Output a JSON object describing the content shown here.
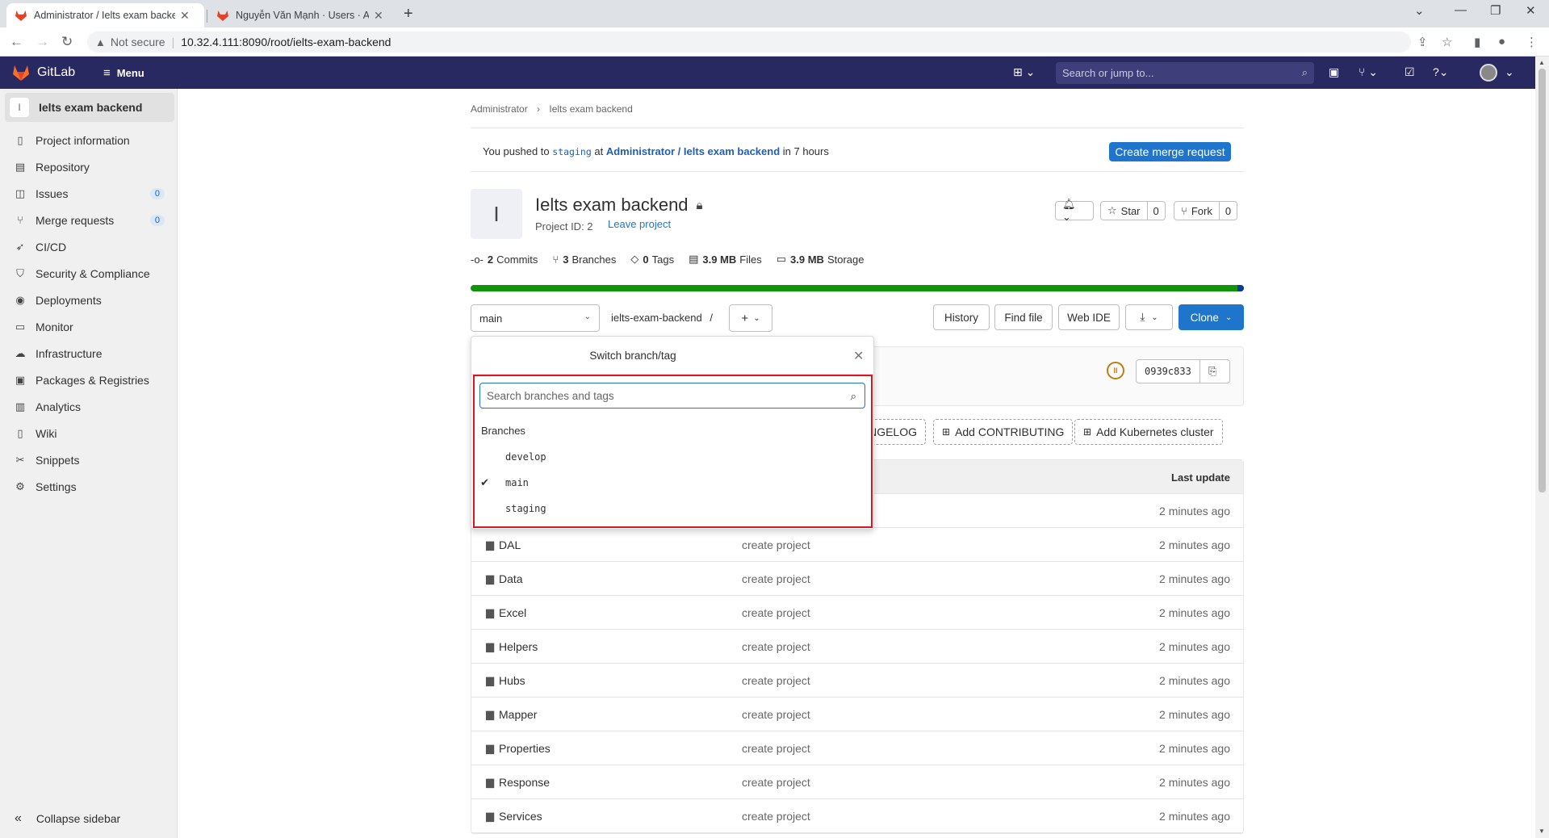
{
  "browser": {
    "tabs": [
      {
        "title": "Administrator / Ielts exam backend",
        "active": true
      },
      {
        "title": "Nguyễn Văn Mạnh · Users · Admin",
        "active": false
      }
    ],
    "url_warning": "Not secure",
    "url": "10.32.4.111:8090/root/ielts-exam-backend"
  },
  "header": {
    "brand": "GitLab",
    "menu_label": "Menu",
    "search_placeholder": "Search or jump to..."
  },
  "sidebar": {
    "project_initial": "I",
    "project_name": "Ielts exam backend",
    "items": [
      {
        "label": "Project information",
        "icon": "info-doc-icon"
      },
      {
        "label": "Repository",
        "icon": "doc-icon"
      },
      {
        "label": "Issues",
        "icon": "issues-icon",
        "badge": "0"
      },
      {
        "label": "Merge requests",
        "icon": "merge-request-icon",
        "badge": "0"
      },
      {
        "label": "CI/CD",
        "icon": "rocket-icon"
      },
      {
        "label": "Security & Compliance",
        "icon": "shield-icon"
      },
      {
        "label": "Deployments",
        "icon": "deployments-icon"
      },
      {
        "label": "Monitor",
        "icon": "monitor-icon"
      },
      {
        "label": "Infrastructure",
        "icon": "cloud-icon"
      },
      {
        "label": "Packages & Registries",
        "icon": "package-icon"
      },
      {
        "label": "Analytics",
        "icon": "chart-icon"
      },
      {
        "label": "Wiki",
        "icon": "book-icon"
      },
      {
        "label": "Snippets",
        "icon": "scissors-icon"
      },
      {
        "label": "Settings",
        "icon": "gear-icon"
      }
    ],
    "collapse_label": "Collapse sidebar"
  },
  "breadcrumb": {
    "parent": "Administrator",
    "current": "Ielts exam backend"
  },
  "push_alert": {
    "prefix": "You pushed to",
    "branch": "staging",
    "at": "at",
    "project": "Administrator / Ielts exam backend",
    "suffix": "in 7 hours",
    "button": "Create merge request"
  },
  "project": {
    "avatar_initial": "I",
    "title": "Ielts exam backend",
    "project_id": "Project ID: 2",
    "leave": "Leave project",
    "star_label": "Star",
    "star_count": "0",
    "fork_label": "Fork",
    "fork_count": "0"
  },
  "stats": [
    {
      "value": "2",
      "label": "Commits"
    },
    {
      "value": "3",
      "label": "Branches"
    },
    {
      "value": "0",
      "label": "Tags"
    },
    {
      "value": "3.9 MB",
      "label": "Files"
    },
    {
      "value": "3.9 MB",
      "label": "Storage"
    }
  ],
  "repo_toolbar": {
    "current_branch": "main",
    "path": "ielts-exam-backend",
    "path_sep": "/",
    "history": "History",
    "find_file": "Find file",
    "web_ide": "Web IDE",
    "clone": "Clone"
  },
  "commit": {
    "sha": "0939c833"
  },
  "quick_actions": {
    "changelog_partial": "NGELOG",
    "add_contributing": "Add CONTRIBUTING",
    "add_kubernetes": "Add Kubernetes cluster"
  },
  "file_table": {
    "last_update_header": "Last update",
    "first_row_date": "2 minutes ago",
    "rows": [
      {
        "name": "DAL",
        "message": "create project",
        "date": "2 minutes ago"
      },
      {
        "name": "Data",
        "message": "create project",
        "date": "2 minutes ago"
      },
      {
        "name": "Excel",
        "message": "create project",
        "date": "2 minutes ago"
      },
      {
        "name": "Helpers",
        "message": "create project",
        "date": "2 minutes ago"
      },
      {
        "name": "Hubs",
        "message": "create project",
        "date": "2 minutes ago"
      },
      {
        "name": "Mapper",
        "message": "create project",
        "date": "2 minutes ago"
      },
      {
        "name": "Properties",
        "message": "create project",
        "date": "2 minutes ago"
      },
      {
        "name": "Response",
        "message": "create project",
        "date": "2 minutes ago"
      },
      {
        "name": "Services",
        "message": "create project",
        "date": "2 minutes ago"
      }
    ]
  },
  "branch_dropdown": {
    "title": "Switch branch/tag",
    "search_placeholder": "Search branches and tags",
    "section_label": "Branches",
    "branches": [
      {
        "name": "develop",
        "selected": false
      },
      {
        "name": "main",
        "selected": true
      },
      {
        "name": "staging",
        "selected": false
      }
    ]
  },
  "colors": {
    "header_bg": "#292961",
    "primary": "#1f75cb",
    "highlight": "#e0141c",
    "language_bar": "#10940a"
  }
}
